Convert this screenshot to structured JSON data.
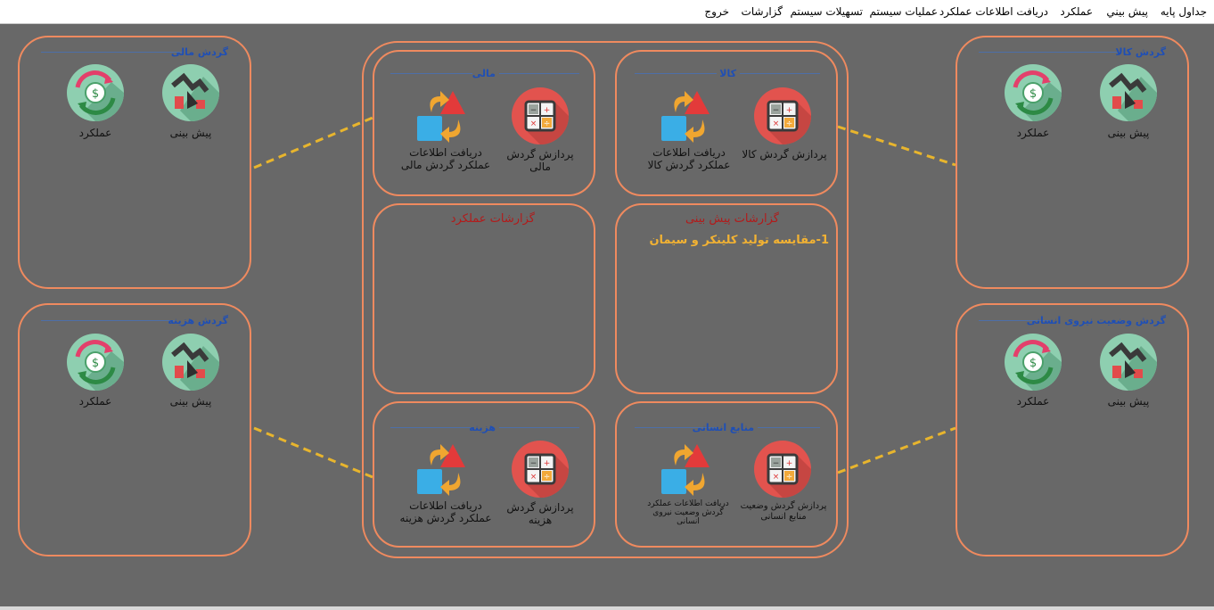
{
  "menu": {
    "basic_tables": "جداول پایه",
    "forecast": "پيش بيني",
    "performance": "عملکرد",
    "receive_data": "دریافت اطلاعات عملکرد",
    "system_ops": "عملیات سیستم",
    "system_tools": "تسهیلات سیستم",
    "reports": "گزارشات",
    "exit": "خروج"
  },
  "side_panels": {
    "goods": {
      "title": "گردش کالا",
      "forecast_label": "پیش بینی",
      "performance_label": "عملکرد"
    },
    "financial": {
      "title": "گردش مالی",
      "forecast_label": "پیش بینی",
      "performance_label": "عملکرد"
    },
    "manpower": {
      "title": "گردش وضعیت نیروی انسانی",
      "forecast_label": "پیش بینی",
      "performance_label": "عملکرد"
    },
    "cost": {
      "title": "گردش هزینه",
      "forecast_label": "پیش بینی",
      "performance_label": "عملکرد"
    }
  },
  "center": {
    "goods": {
      "title": "کالا",
      "process_label": "پردازش گردش کالا",
      "receive_label": "دریافت اطلاعات عملکرد گردش کالا"
    },
    "financial": {
      "title": "مالی",
      "process_label": "پردازش گردش مالی",
      "receive_label": "دریافت اطلاعات عملکرد گردش مالی"
    },
    "forecast_reports": {
      "title": "گزارشات پیش بینی",
      "items": [
        "1-مقایسه تولید کلینکر و سیمان"
      ]
    },
    "performance_reports": {
      "title": "گزارشات عملکرد"
    },
    "manpower": {
      "title": "منابع انسانی",
      "process_label": "پردازش گردش وضعیت منابع انسانی",
      "receive_label": "دریافت اطلاعات عملکرد گردش وضعیت نیروی انسانی"
    },
    "cost": {
      "title": "هزینه",
      "process_label": "پردازش گردش هزینه",
      "receive_label": "دریافت اطلاعات عملکرد گردش هزینه"
    }
  },
  "colors": {
    "background": "#686868",
    "panel_border": "#ef8a5f",
    "connector": "#e8b52d",
    "title_blue": "#1f4fb5",
    "report_title": "#b31a1a",
    "report_link": "#f2b233"
  }
}
